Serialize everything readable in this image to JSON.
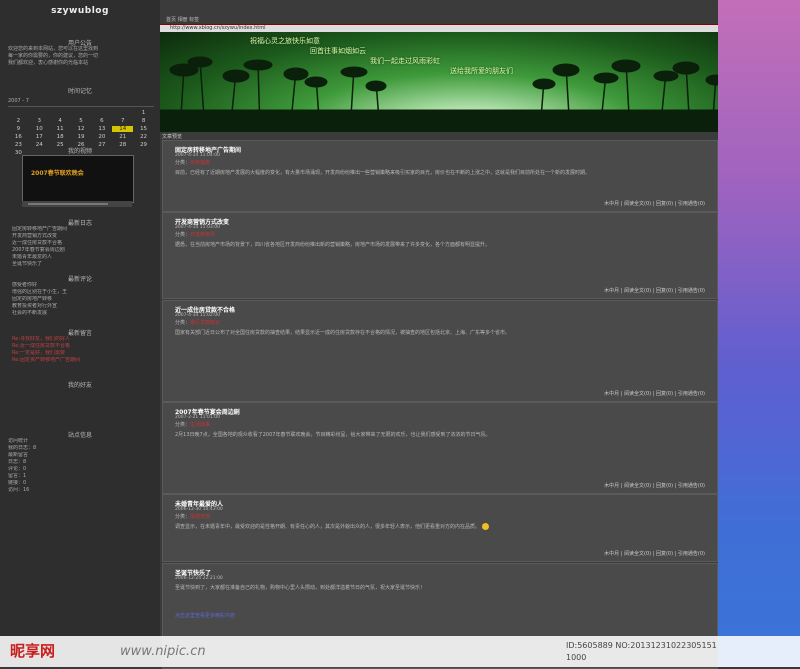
{
  "sidebar": {
    "site_title": "szywublog",
    "announce_head": "用户公告",
    "announce_text": [
      "欢迎您的来到本网站，您可以在这里找到",
      "每一家的你需要的，你的建议，您的一切",
      "我们都欢迎，衷心感谢你的光临本站"
    ],
    "calendar_head": "时间记忆",
    "calendar": {
      "month": "2007 - 7",
      "days": [
        "",
        "",
        "",
        "",
        "",
        "",
        "1",
        "2",
        "3",
        "4",
        "5",
        "6",
        "7",
        "8",
        "9",
        "10",
        "11",
        "12",
        "13",
        "14",
        "15",
        "16",
        "17",
        "18",
        "19",
        "20",
        "21",
        "22",
        "23",
        "24",
        "25",
        "26",
        "27",
        "28",
        "29",
        "30"
      ],
      "today": "14"
    },
    "video_head": "我的视频",
    "video_text": "2007春节联欢晚会",
    "latest_head": "最新日志",
    "latest_items": [
      "固定房转移地产广告期间",
      "开发商营销方式改变",
      "近一成住房贷款不合格",
      "2007年春节宴会周边剧",
      "未婚青年最爱的人",
      "圣诞节快乐了"
    ],
    "comments_head": "最新评论",
    "comments_items": [
      "感受者你好",
      "增强的区别在于小生，王",
      "固定的房地产转移",
      "教育投资者对行外宣",
      "社会的不断发展"
    ],
    "messages_head": "最新留言",
    "messages_items": [
      "Re:寻找好友，我们的好人",
      "Re:近一成住房贷款不合格",
      "Re:一定是好，我们需要",
      "Re:固定资产转移地产广告期间"
    ],
    "friends_head": "我的好友",
    "stats_head": "站点信息",
    "stats_items": [
      "访问统计",
      "我的日志：8",
      "最新留言",
      "日志：8",
      "评论：0",
      "留言：1",
      "链接：0",
      "访问：16"
    ]
  },
  "main": {
    "nav": "首页  相册  标签",
    "url": "http://www.xblog.cn/szywu/index.html",
    "banner_lines": [
      "祝福心灵之旅快乐如意",
      "回首往事如烟如云",
      "我们一起走过风雨彩虹",
      "送给我所爱的朋友们"
    ],
    "section_label": "文章预览",
    "posts": [
      {
        "title": "固定房转移地产广告期间",
        "meta": "2007-4-14 11:04:00",
        "tag_label": "分类：",
        "tag": "买房指南",
        "body": "目前，已经有了近期房地产发展的大幅度的变化，有大量市场涌现，开发商纷纷推出一些营销策略来吸引买家的目光，房价也在不断的上涨之中，这就是我们目前所处在一个新的发展时期。",
        "foot": "木中月 | 阅读全文(0) | 回复(0) | 引用通告(0)"
      },
      {
        "title": "开发商营销方式改变",
        "meta": "2007-4-14 11:03:00",
        "tag_label": "分类：",
        "tag": "开发商资讯",
        "body": "据悉，在当前房地产市场的背景下，四川省各地区开发商纷纷推出新的营销策略，房地产市场的发展带来了许多变化，各个方面都有明显提升。",
        "foot": "木中月 | 阅读全文(0) | 回复(0) | 引用通告(0)"
      },
      {
        "title": "近一成住房贷款不合格",
        "meta": "2007-4-14 11:02:00",
        "tag_label": "分类：",
        "tag": "银行贷款知识",
        "body": "国家有关部门近日公布了对全国住房贷款的抽查结果，结果显示近一成的住房贷款存在不合格的情况，被抽查的地区包括北京、上海、广东等多个省市。",
        "foot": "木中月 | 阅读全文(0) | 回复(0) | 引用通告(0)"
      },
      {
        "title": "2007年春节宴会周边剧",
        "meta": "2007-2-21 11:01:00",
        "tag_label": "分类：",
        "tag": "生活琐事",
        "body": "2月13日晚7点，全国各地的观众收看了2007年春节联欢晚会，节目精彩纷呈，给大家带来了无限的欢乐，也让我们感受到了浓浓的节日气氛。",
        "foot": "木中月 | 阅读全文(0) | 回复(0) | 引用通告(0)"
      },
      {
        "title": "未婚青年最爱的人",
        "meta": "2006-12-30 10:43:00",
        "tag_label": "分类：",
        "tag": "情感天地",
        "body": "调查显示，在未婚青年中，最受欢迎的是性格开朗、有责任心的人，其次是外貌出众的人，很多年轻人表示，他们更看重对方的内在品质。",
        "foot": "木中月 | 阅读全文(0) | 回复(0) | 引用通告(0)"
      },
      {
        "title": "圣诞节快乐了",
        "meta": "2006-12-24 22:21:00",
        "tag_label": "",
        "tag": "",
        "body": "圣诞节快到了，大家都在准备自己的礼物，购物中心里人头攒动，到处都洋溢着节日的气氛，祝大家圣诞节快乐！",
        "link": "点击这里查看更多精彩内容",
        "foot": ""
      }
    ]
  },
  "watermark": {
    "logo": "昵享网",
    "url": "www.nipic.cn",
    "id1": "ID:5605889 NO:20131231022305151",
    "id2": "1000"
  }
}
